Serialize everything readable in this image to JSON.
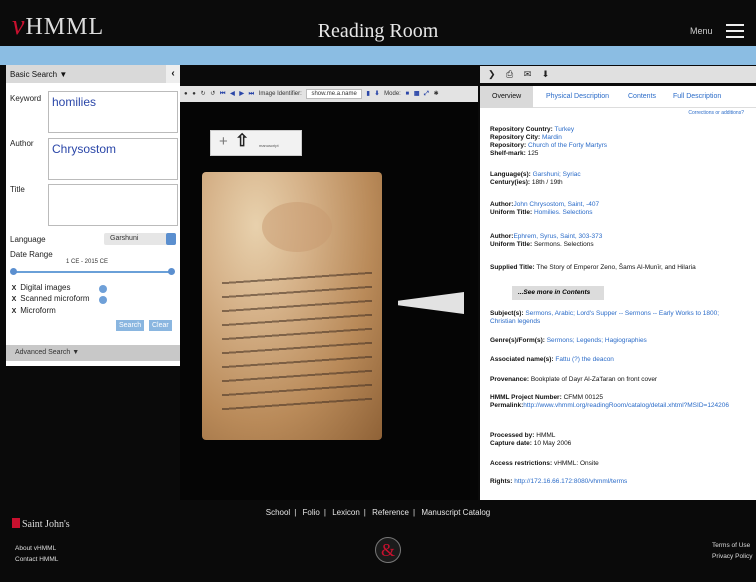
{
  "header": {
    "logo_v": "v",
    "logo_text": "HMML",
    "title": "Reading Room",
    "menu_label": "Menu"
  },
  "search": {
    "mode": "Basic Search ▼",
    "collapse": "‹",
    "keyword_label": "Keyword",
    "keyword_value": "homilies",
    "author_label": "Author",
    "author_value": "Chrysostom",
    "title_label": "Title",
    "title_value": "",
    "language_label": "Language",
    "language_value": "Garshuni",
    "date_label": "Date Range",
    "date_value": "1 CE - 2015 CE",
    "date_range": [
      1,
      2015
    ],
    "checks": [
      {
        "label": "Digital images",
        "checked": true
      },
      {
        "label": "Scanned microform",
        "checked": true
      },
      {
        "label": "Microform",
        "checked": true
      }
    ],
    "search_btn": "Search",
    "clear_btn": "Clear",
    "advanced": "Advanced Search ▼"
  },
  "viewer": {
    "toolbar": [
      "●",
      "●",
      "↻",
      "↺",
      "⏮",
      "◀",
      "▶",
      "⏭"
    ],
    "id_label": "Image Identifier:",
    "id_placeholder": "show.me.a.name",
    "mode_label": "Mode:",
    "zoom_plus": "+",
    "zoom_text": "manuscript"
  },
  "record": {
    "actions": "❯ ⎙ ✉ ⬇",
    "tabs": [
      "Overview",
      "Physical Description",
      "Contents",
      "Full Description"
    ],
    "corrections": "Corrections or additions?",
    "repo_country_l": "Repository Country:",
    "repo_country": "Turkey",
    "repo_city_l": "Repository City:",
    "repo_city": "Mardin",
    "repo_l": "Repository:",
    "repo": "Church of the Forty Martyrs",
    "shelf_l": "Shelf-mark:",
    "shelf": "125",
    "lang_l": "Language(s):",
    "lang": "Garshuni; Syriac",
    "century_l": "Century(ies):",
    "century": "18th / 19th",
    "author1_l": "Author:",
    "author1": "John Chrysostom, Saint, -407",
    "ut1_l": "Uniform Title:",
    "ut1": "Homilies. Selections",
    "author2_l": "Author:",
    "author2": "Ephrem, Syrus, Saint, 303-373",
    "ut2_l": "Uniform Title:",
    "ut2": "Sermons. Selections",
    "supplied_l": "Supplied Title:",
    "supplied": "The Story of Emperor Zeno, Šams Al-Munīr, and Hilaria",
    "seemore": "...See more in Contents",
    "subjects_l": "Subject(s):",
    "subjects": "Sermons, Arabic; Lord's Supper -- Sermons -- Early Works to 1800; Christian legends",
    "genre_l": "Genre(s)/Form(s):",
    "genre": "Sermons; Legends; Hagiographies",
    "names_l": "Associated name(s):",
    "names": "Fattu (?) the deacon",
    "prov_l": "Provenance:",
    "prov": "Bookplate of Dayr Al-Za'faran on front cover",
    "proj_l": "HMML Project Number:",
    "proj": "CFMM 00125",
    "perma_l": "Permalink:",
    "perma": "http://www.vhmml.org/readingRoom/catalog/detail.xhtml?MSID=124206",
    "proc_l": "Processed by:",
    "proc": "HMML",
    "cap_l": "Capture date:",
    "cap": "10 May 2006",
    "access_l": "Access restrictions:",
    "access": "vHMML: Onsite",
    "rights_l": "Rights:",
    "rights": "http://172.16.66.172:8080/vhmml/terms"
  },
  "footer": {
    "links": [
      "School",
      "Folio",
      "Lexicon",
      "Reference",
      "Manuscript Catalog"
    ],
    "sep": "|",
    "sj": "Saint John's",
    "about": "About vHMML",
    "contact": "Contact HMML",
    "amp": "&",
    "terms": "Terms of Use",
    "privacy": "Privacy Policy"
  }
}
